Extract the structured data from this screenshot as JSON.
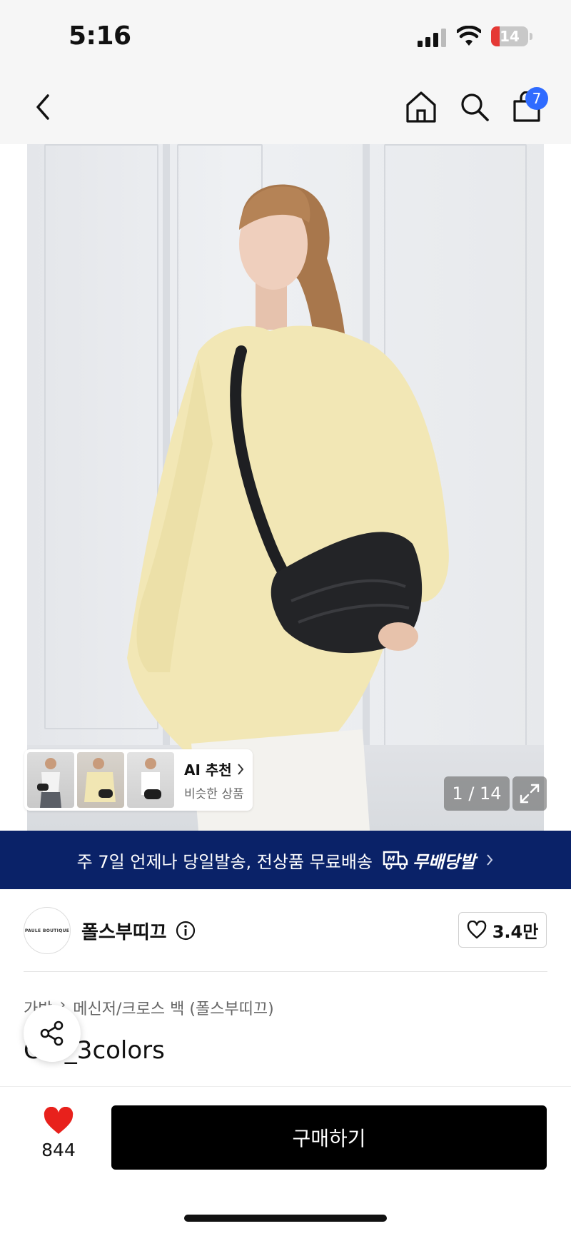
{
  "status_bar": {
    "time": "5:16",
    "battery_level": "14",
    "battery_fraction": 0.14
  },
  "nav": {
    "cart_count": "7",
    "icons": [
      "back-icon",
      "home-icon",
      "search-icon",
      "shopping-bag-icon"
    ]
  },
  "gallery": {
    "pager": "1 / 14",
    "ai_title": "AI 추천",
    "ai_subtitle": "비슷한 상품"
  },
  "banner": {
    "text": "주 7일 언제나 당일발송, 전상품 무료배송",
    "badge": "무배당발"
  },
  "store": {
    "logo_text": "PAULE BOUTIQUE",
    "name": "폴스부띠끄",
    "likes": "3.4만"
  },
  "product": {
    "breadcrumb": [
      "가방",
      "메신저/크로스 백 (폴스부띠끄)"
    ],
    "title": "C  A_3colors"
  },
  "bottom": {
    "wish_count": "844",
    "buy_label": "구매하기"
  },
  "colors": {
    "banner_bg": "#0a2268",
    "badge_blue": "#2f6bff",
    "heart_red": "#e8211c",
    "buy_bg": "#000000"
  }
}
